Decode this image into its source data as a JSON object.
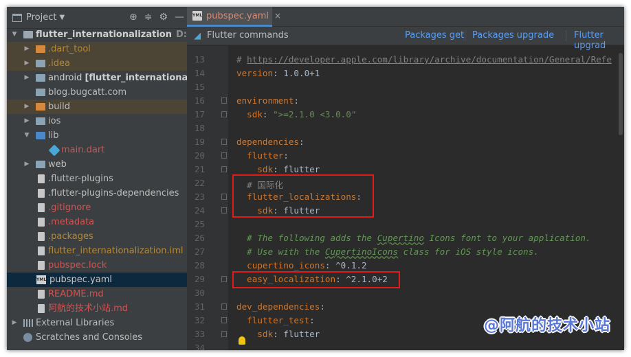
{
  "project_panel": {
    "title": "Project",
    "items": [
      {
        "label": "flutter_internationalization",
        "path": "D:\\Code",
        "icon": "module-folder-icon"
      },
      {
        "label": ".dart_tool",
        "icon": "folder-excluded-icon"
      },
      {
        "label": ".idea",
        "icon": "folder-icon"
      },
      {
        "label": "android",
        "extra": "[flutter_internationalizat",
        "icon": "android-folder-icon"
      },
      {
        "label": "blog.bugcatt.com",
        "icon": "folder-icon"
      },
      {
        "label": "build",
        "icon": "folder-excluded-icon"
      },
      {
        "label": "ios",
        "icon": "folder-icon"
      },
      {
        "label": "lib",
        "icon": "source-folder-icon"
      },
      {
        "label": "main.dart",
        "icon": "dart-file-icon"
      },
      {
        "label": "web",
        "icon": "web-folder-icon"
      },
      {
        "label": ".flutter-plugins",
        "icon": "file-icon"
      },
      {
        "label": ".flutter-plugins-dependencies",
        "icon": "file-icon"
      },
      {
        "label": ".gitignore",
        "icon": "file-icon"
      },
      {
        "label": ".metadata",
        "icon": "file-icon"
      },
      {
        "label": ".packages",
        "icon": "file-icon"
      },
      {
        "label": "flutter_internationalization.iml",
        "icon": "iml-file-icon"
      },
      {
        "label": "pubspec.lock",
        "icon": "file-icon"
      },
      {
        "label": "pubspec.yaml",
        "icon": "yaml-file-icon"
      },
      {
        "label": "README.md",
        "icon": "markdown-file-icon"
      },
      {
        "label": "阿航的技术小站.md",
        "icon": "markdown-file-icon"
      },
      {
        "label": "External Libraries",
        "icon": "library-icon"
      },
      {
        "label": "Scratches and Consoles",
        "icon": "scratch-icon"
      }
    ]
  },
  "editor": {
    "tab_label": "pubspec.yaml",
    "tab_icon_text": "YML",
    "commands_title": "Flutter commands",
    "links": [
      "Packages get",
      "Packages upgrade",
      "Flutter upgrad"
    ],
    "lines": [
      {
        "n": "13"
      },
      {
        "n": "14"
      },
      {
        "n": "15"
      },
      {
        "n": "16"
      },
      {
        "n": "17"
      },
      {
        "n": "18"
      },
      {
        "n": "19"
      },
      {
        "n": "20"
      },
      {
        "n": "21"
      },
      {
        "n": "22"
      },
      {
        "n": "23"
      },
      {
        "n": "24"
      },
      {
        "n": "25"
      },
      {
        "n": "26"
      },
      {
        "n": "27"
      },
      {
        "n": "28"
      },
      {
        "n": "29"
      },
      {
        "n": "30"
      },
      {
        "n": "31"
      },
      {
        "n": "32"
      },
      {
        "n": "33"
      },
      {
        "n": "34"
      }
    ],
    "code": {
      "l13_hash": "# ",
      "l13_url": "https://developer.apple.com/library/archive/documentation/General/Refe",
      "l14_key": "version",
      "l14_val": ": 1.0.0+1",
      "l16_key": "environment",
      "l16_colon": ":",
      "l17_key": "  sdk",
      "l17_colon": ": ",
      "l17_val": "\">=2.1.0 <3.0.0\"",
      "l19_key": "dependencies",
      "l20_key": "  flutter",
      "l21_key": "    sdk",
      "l21_val": ": flutter",
      "l22_comment": "  # 国际化",
      "l23_key": "  flutter_localizations",
      "l24_key": "    sdk",
      "l24_val": ": flutter",
      "l26_a": "  # The following adds the ",
      "l26_b": "Cupertino",
      "l26_c": " Icons font to your application.",
      "l27_a": "  # Use with the ",
      "l27_b": "CupertinoIcons",
      "l27_c": " class for iOS style icons.",
      "l28_key": "  cupertino_icons",
      "l28_val": ": ^0.1.2",
      "l29_key": "  easy_localization",
      "l29_val": ": ^2.1.0+2",
      "l31_key": "dev_dependencies",
      "l32_key": "  flutter_test",
      "l33_key": "    sdk",
      "l33_val": ": flutter"
    }
  },
  "watermark": "@阿航的技术小站",
  "colors": {
    "keyword": "#cc7832",
    "string": "#6a8759",
    "comment": "#629755",
    "highlight_box": "#e01b1b",
    "link": "#589df6"
  }
}
